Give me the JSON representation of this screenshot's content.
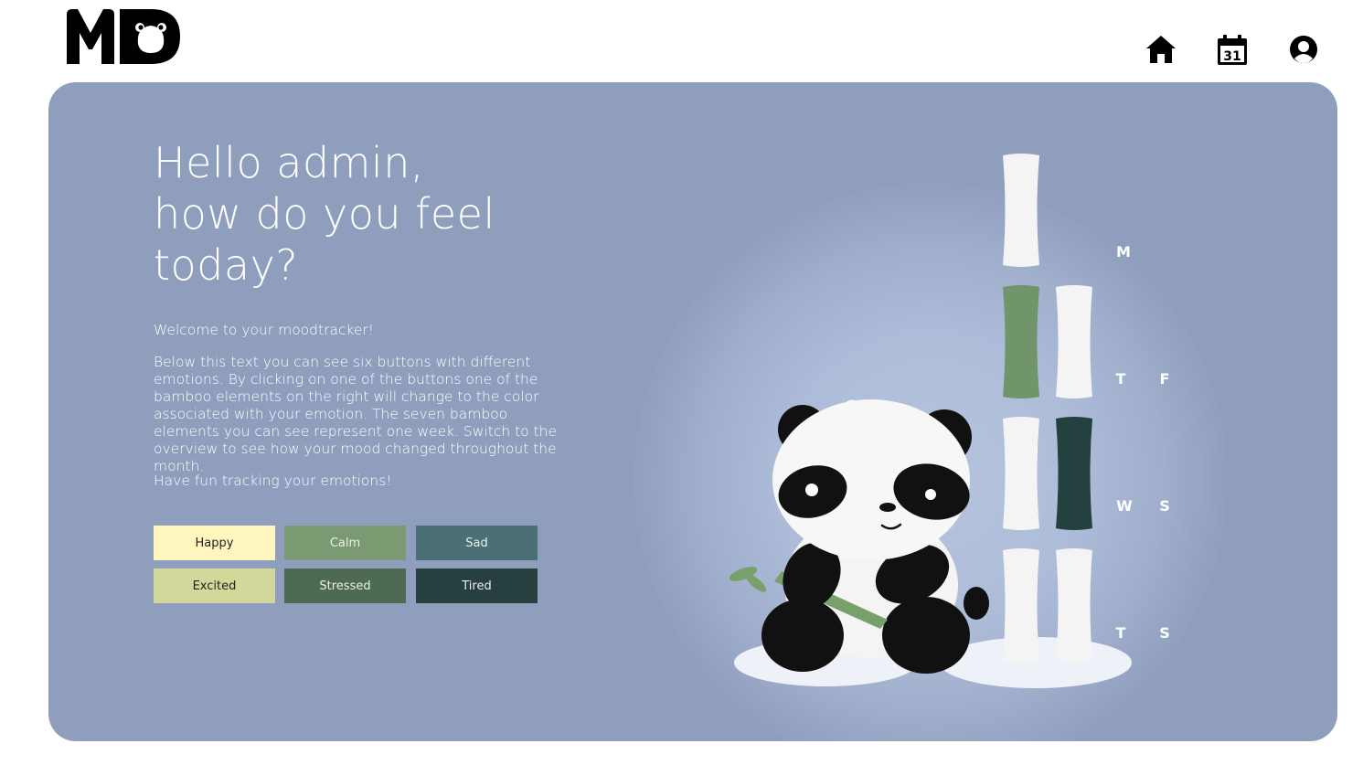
{
  "header": {
    "logo_text": "MD",
    "icons": [
      "home-icon",
      "calendar-icon",
      "account-icon"
    ],
    "calendar_day": "31"
  },
  "main": {
    "greeting_lines": [
      "Hello admin,",
      "how do you feel",
      "today?"
    ],
    "welcome": "Welcome to your moodtracker!",
    "description": "Below this text you can see six buttons with different emotions. By clicking on one of the buttons one of the bamboo elements on the right will change to the color associated with your emotion. The seven bamboo elements you can see represent one week. Switch to the overview to see how your mood changed throughout the month.",
    "closing": "Have fun tracking your emotions!"
  },
  "moods": [
    {
      "label": "Happy",
      "color": "#fff5bd",
      "text_color": "#222222"
    },
    {
      "label": "Calm",
      "color": "#7a9a72",
      "text_color": "#eeeeee"
    },
    {
      "label": "Sad",
      "color": "#4a7075",
      "text_color": "#eeeeee"
    },
    {
      "label": "Excited",
      "color": "#d1d89a",
      "text_color": "#222222"
    },
    {
      "label": "Stressed",
      "color": "#4c6b52",
      "text_color": "#eeeeee"
    },
    {
      "label": "Tired",
      "color": "#26403f",
      "text_color": "#eeeeee"
    }
  ],
  "week": {
    "days": [
      "M",
      "T",
      "W",
      "T",
      "F",
      "S",
      "S"
    ],
    "segment_colors": {
      "M": "#f4f4f4",
      "T1": "#71956b",
      "W": "#f4f4f4",
      "T2": "#f4f4f4",
      "F": "#f4f4f4",
      "S1": "#24403f",
      "S2": "#f4f4f4"
    }
  },
  "colors": {
    "panel": "#8f9ebd",
    "text": "#ffffff"
  }
}
